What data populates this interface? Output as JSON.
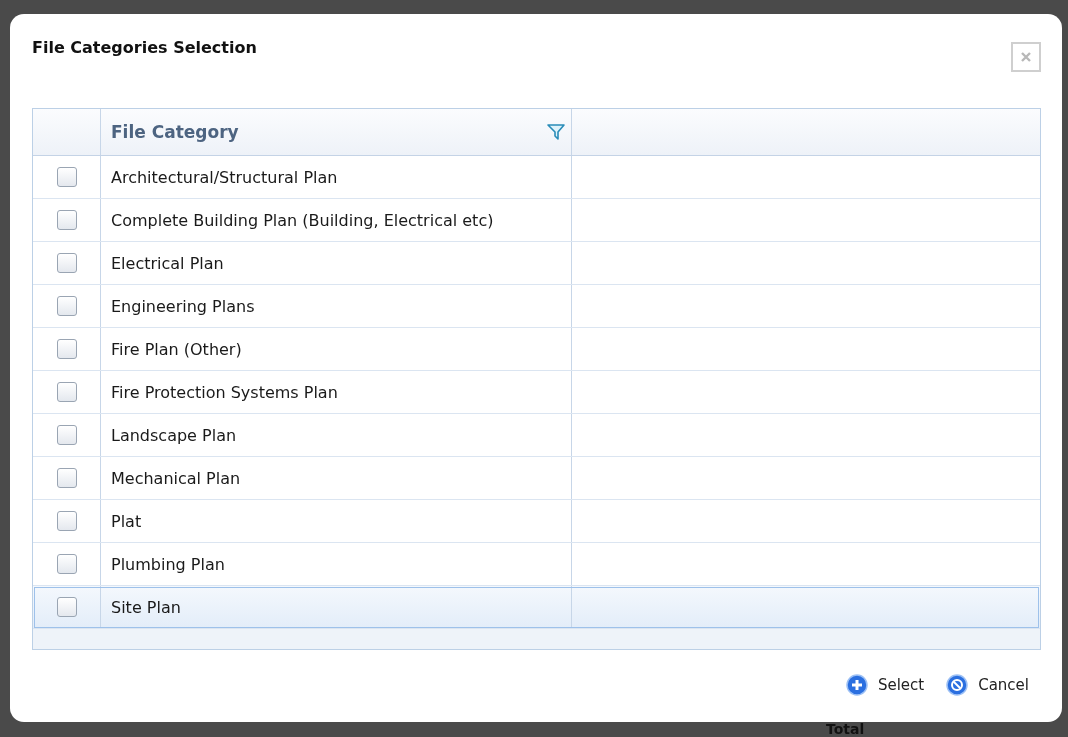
{
  "dialog": {
    "title": "File Categories Selection"
  },
  "table": {
    "columns": [
      "File Category"
    ],
    "rows": [
      {
        "category": "Architectural/Structural Plan",
        "checked": false,
        "highlighted": false
      },
      {
        "category": "Complete Building Plan (Building, Electrical etc)",
        "checked": false,
        "highlighted": false
      },
      {
        "category": "Electrical Plan",
        "checked": false,
        "highlighted": false
      },
      {
        "category": "Engineering Plans",
        "checked": false,
        "highlighted": false
      },
      {
        "category": "Fire Plan (Other)",
        "checked": false,
        "highlighted": false
      },
      {
        "category": "Fire Protection Systems Plan",
        "checked": false,
        "highlighted": false
      },
      {
        "category": "Landscape Plan",
        "checked": false,
        "highlighted": false
      },
      {
        "category": "Mechanical Plan",
        "checked": false,
        "highlighted": false
      },
      {
        "category": "Plat",
        "checked": false,
        "highlighted": false
      },
      {
        "category": "Plumbing Plan",
        "checked": false,
        "highlighted": false
      },
      {
        "category": "Site Plan",
        "checked": false,
        "highlighted": true
      }
    ]
  },
  "buttons": [
    {
      "label": "Select",
      "kind": "add"
    },
    {
      "label": "Cancel",
      "kind": "cancel"
    }
  ],
  "background": {
    "label": "Total"
  }
}
